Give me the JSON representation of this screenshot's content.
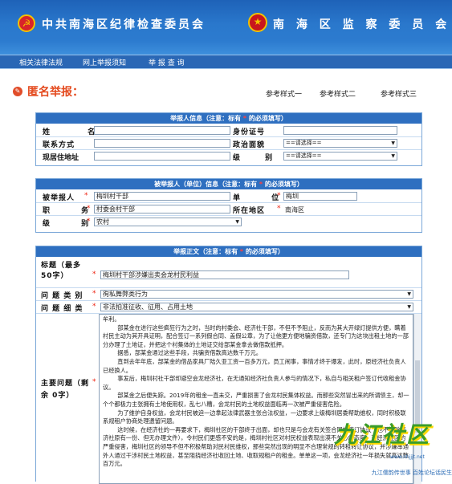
{
  "banner": {
    "left_title": "中共南海区纪律检查委员会",
    "right_title": "南 海 区 监 察 委 员 会"
  },
  "nav": {
    "items": [
      "相关法律法规",
      "网上举报须知",
      "举 报 查 询"
    ]
  },
  "page": {
    "title": "匿名举报：",
    "references": [
      "参考样式一",
      "参考样式二",
      "参考样式三"
    ]
  },
  "reporter_section": {
    "header_prefix": "举报人信息（注意：标有 ",
    "header_star": "*",
    "header_suffix": " 的必须填写）",
    "name_label": "姓 名",
    "id_label": "身份证号",
    "contact_label": "联系方式",
    "politics_label": "政治面貌",
    "politics_value": "==请选择==",
    "address_label": "现居住地址",
    "level_label": "级 别",
    "level_value": "==请选择=="
  },
  "reported_section": {
    "header_prefix": "被举报人（单位）信息（注意：标有 ",
    "header_star": "*",
    "header_suffix": " 的必须填写）",
    "reported_label": "被举报人",
    "reported_value": "梅圳村干部",
    "unit_label": "单 位",
    "unit_value": "梅圳",
    "position_label": "职 务",
    "position_value": "村委会村干部",
    "region_label": "所在地区",
    "region_value": "南海区",
    "grade_label": "级 别",
    "grade_value": "农村"
  },
  "body_section": {
    "header_prefix": "举报正文（注意：标有 ",
    "header_star": "*",
    "header_suffix": " 的必须填写）",
    "title_label": "标题（最多50字）",
    "title_value": "梅圳村干部涉嫌出卖会龙村民利益",
    "category_label": "问 题 类 别",
    "category_value": "徇私舞弊类行为",
    "detail_label": "问 题 细 类",
    "detail_value": "非法拍准征收、征用、占用土地",
    "content_label": "主要问题（剩余 0字）",
    "content_text": "牟利。\n        部某金在进行这些疯狂行为之时，当时的村委会、经济社干部，不但不予阻止，反而为其大开绿灯提供方便，瞒着村民主动为其开具证明，配合签订一系列假合同、盖假公章，为了让他更方便地骗资借款，还专门为这块出租土地的一部分办理了土地证，并把这个村集体的土地证交给部某金拿去做借款抵押。\n        据悉，部某金通过这些手段，共骗资借款高达数千万元。\n        直到去年年底，部某金的借品家具厂陆久亚工资一百多万元，员工闹事，事情才终于爆发，此时，原经济社负责人已经换人。\n        事发后，梅圳村社干部却避空会龙经济社，在无通知经济社负责人参与的情况下，私自与相关租户签订代收租金协议。\n        部某金之后便失踪。2019年的租金一直未交，严重损害了会龙村民集体权益。而那些突然冒出来的所谓债主，却一个个都极力主张拥有土地使用权，乱七八糟，会龙村民的土地权益面临再一次被严重侵害危险。\n        为了维护自身权益，会龙村民被迫一边拿起法律武器主张合法权益，一边要求上级梅圳居委帮助维权，同时积极联系规租户协商处理遗留问题。\n        这时候，在经济社的一再要求下，梅圳社区的干部终于出面，却也只是与会龙有关签合同的签订协议（也不排除经济社原有一份、但无办理文件），令村民们更感不安的是，梅圳村社区对村民权益表现出漠不关心的态度，对经济社区的严重侵害，梅圳社区的领导不但不积极帮助对民村民维权，那些突然出现的明显不合理常规的转租转让协议，并涉嫌串通外人通过干涉村民土地权益，甚至阻挠经济社收回土地、收取规租户的租金。单单这一项，会龙经济社一年损失就高达数百万元。"
  },
  "watermark": {
    "brand": "九江社区",
    "url": "www.nhjjjt.net"
  },
  "footer": {
    "slogan": "九江儒韵传世事 百姓论坛话民生"
  }
}
